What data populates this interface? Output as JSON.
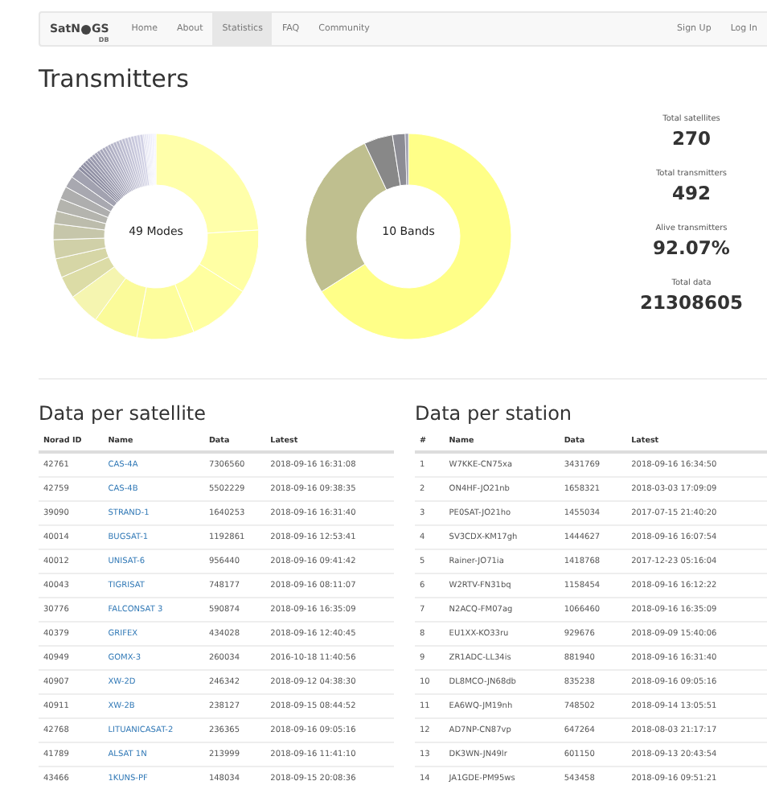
{
  "navbar": {
    "logo": {
      "left": "SatN",
      "right": "GS",
      "sub": "DB"
    },
    "links": [
      {
        "label": "Home",
        "selected": false
      },
      {
        "label": "About",
        "selected": false
      },
      {
        "label": "Statistics",
        "selected": true
      },
      {
        "label": "FAQ",
        "selected": false
      },
      {
        "label": "Community",
        "selected": false
      }
    ],
    "account_links": [
      "Sign Up",
      "Log In"
    ]
  },
  "transmitters": {
    "title": "Transmitters",
    "donuts": [
      {
        "kind": "modes",
        "center_label": "49 Modes"
      },
      {
        "kind": "bands",
        "center_label": "10 Bands"
      }
    ],
    "stats": [
      {
        "label": "Total satellites",
        "value": "270"
      },
      {
        "label": "Total transmitters",
        "value": "492"
      },
      {
        "label": "Alive transmitters",
        "value": "92.07%"
      },
      {
        "label": "Total data",
        "value": "21308605"
      }
    ]
  },
  "satellite_table": {
    "title": "Data per satellite",
    "columns": [
      "Norad ID",
      "Name",
      "Data",
      "Latest"
    ],
    "rows": [
      [
        "42761",
        "CAS-4A",
        "7306560",
        "2018-09-16 16:31:08"
      ],
      [
        "42759",
        "CAS-4B",
        "5502229",
        "2018-09-16 09:38:35"
      ],
      [
        "39090",
        "STRAND-1",
        "1640253",
        "2018-09-16 16:31:40"
      ],
      [
        "40014",
        "BUGSAT-1",
        "1192861",
        "2018-09-16 12:53:41"
      ],
      [
        "40012",
        "UNISAT-6",
        "956440",
        "2018-09-16 09:41:42"
      ],
      [
        "40043",
        "TIGRISAT",
        "748177",
        "2018-09-16 08:11:07"
      ],
      [
        "30776",
        "FALCONSAT 3",
        "590874",
        "2018-09-16 16:35:09"
      ],
      [
        "40379",
        "GRIFEX",
        "434028",
        "2018-09-16 12:40:45"
      ],
      [
        "40949",
        "GOMX-3",
        "260034",
        "2016-10-18 11:40:56"
      ],
      [
        "40907",
        "XW-2D",
        "246342",
        "2018-09-12 04:38:30"
      ],
      [
        "40911",
        "XW-2B",
        "238127",
        "2018-09-15 08:44:52"
      ],
      [
        "42768",
        "LITUANICASAT-2",
        "236365",
        "2018-09-16 09:05:16"
      ],
      [
        "41789",
        "ALSAT 1N",
        "213999",
        "2018-09-16 11:41:10"
      ],
      [
        "43466",
        "1KUNS-PF",
        "148034",
        "2018-09-15 20:08:36"
      ]
    ]
  },
  "station_table": {
    "title": "Data per station",
    "columns": [
      "#",
      "Name",
      "Data",
      "Latest"
    ],
    "rows": [
      [
        "1",
        "W7KKE-CN75xa",
        "3431769",
        "2018-09-16 16:34:50"
      ],
      [
        "2",
        "ON4HF-JO21nb",
        "1658321",
        "2018-03-03 17:09:09"
      ],
      [
        "3",
        "PE0SAT-JO21ho",
        "1455034",
        "2017-07-15 21:40:20"
      ],
      [
        "4",
        "SV3CDX-KM17gh",
        "1444627",
        "2018-09-16 16:07:54"
      ],
      [
        "5",
        "Rainer-JO71ia",
        "1418768",
        "2017-12-23 05:16:04"
      ],
      [
        "6",
        "W2RTV-FN31bq",
        "1158454",
        "2018-09-16 16:12:22"
      ],
      [
        "7",
        "N2ACQ-FM07ag",
        "1066460",
        "2018-09-16 16:35:09"
      ],
      [
        "8",
        "EU1XX-KO33ru",
        "929676",
        "2018-09-09 15:40:06"
      ],
      [
        "9",
        "ZR1ADC-LL34is",
        "881940",
        "2018-09-16 16:31:40"
      ],
      [
        "10",
        "DL8MCO-JN68db",
        "835238",
        "2018-09-16 09:05:16"
      ],
      [
        "11",
        "EA6WQ-JM19nh",
        "748502",
        "2018-09-14 13:05:51"
      ],
      [
        "12",
        "AD7NP-CN87vp",
        "647264",
        "2018-08-03 21:17:17"
      ],
      [
        "13",
        "DK3WN-JN49lr",
        "601150",
        "2018-09-13 20:43:54"
      ],
      [
        "14",
        "JA1GDE-PM95ws",
        "543458",
        "2018-09-16 09:51:21"
      ]
    ]
  }
}
